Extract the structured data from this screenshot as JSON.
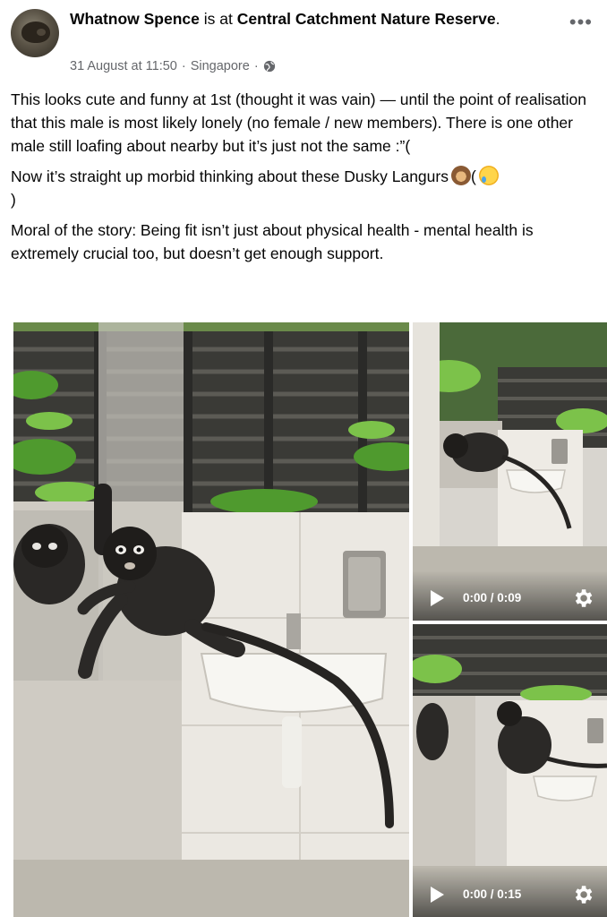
{
  "post": {
    "author": "Whatnow Spence",
    "is_at": "is at",
    "location": "Central Catchment Nature Reserve",
    "location_suffix": ".",
    "date": "31 August at 11:50",
    "dot": " · ",
    "place": "Singapore",
    "dot2": " ·",
    "more": "•••",
    "paragraph1": "This looks cute and funny at 1st (thought it was vain) — until the point of realisation that this male is most likely lonely (no female / new members). There is one other male still loafing about nearby but it’s just not the same :”(",
    "paragraph2": "Now it’s straight up morbid thinking about these Dusky Langurs",
    "paragraph2_tail1": "(",
    "paragraph2_tail2": ")",
    "paragraph3": "Moral of the story: Being fit isn’t just about physical health - mental health is extremely crucial too, but doesn’t get enough support."
  },
  "media": {
    "video1": {
      "time": "0:00 / 0:09"
    },
    "video2": {
      "time": "0:00 / 0:15"
    }
  },
  "icons": [
    "globe-icon",
    "more-options-icon",
    "play-icon",
    "settings-gear-icon",
    "see-no-evil-monkey-emoji",
    "sad-tear-face-emoji"
  ],
  "colors": {
    "meta_text": "#65676b",
    "text": "#050505"
  }
}
